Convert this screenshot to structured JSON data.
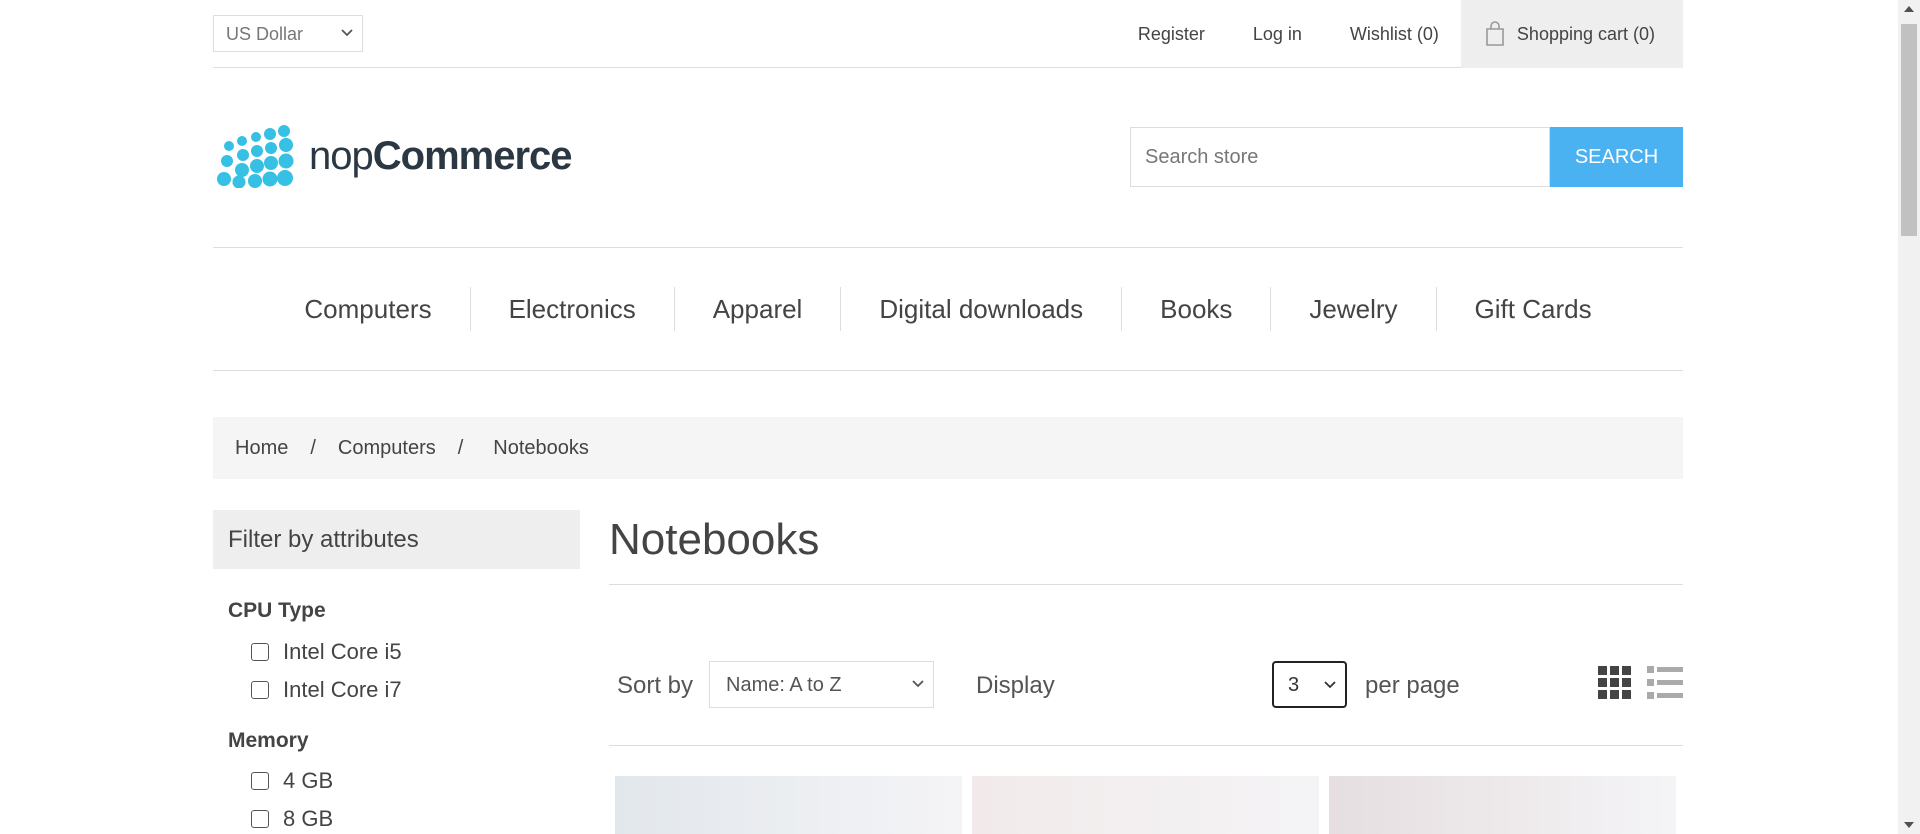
{
  "header": {
    "currency": "US Dollar",
    "links": [
      "Register",
      "Log in",
      "Wishlist (0)"
    ],
    "cart": "Shopping cart (0)"
  },
  "logo": {
    "prefix": "nop",
    "suffix": "Commerce"
  },
  "search": {
    "placeholder": "Search store",
    "button": "SEARCH"
  },
  "menu": [
    "Computers",
    "Electronics",
    "Apparel",
    "Digital downloads",
    "Books",
    "Jewelry",
    "Gift Cards"
  ],
  "breadcrumb": {
    "items": [
      "Home",
      "Computers"
    ],
    "separator": "/",
    "current": "Notebooks"
  },
  "sidebar": {
    "title": "Filter by attributes",
    "groups": [
      {
        "name": "CPU Type",
        "options": [
          "Intel Core i5",
          "Intel Core i7"
        ]
      },
      {
        "name": "Memory",
        "options": [
          "4 GB",
          "8 GB"
        ]
      }
    ]
  },
  "main": {
    "title": "Notebooks",
    "sort_label": "Sort by",
    "sort_value": "Name: A to Z",
    "display_label": "Display",
    "display_value": "3",
    "per_page_label": "per page"
  },
  "colors": {
    "accent": "#4ab2f1",
    "logo_dots": "#36c0e3",
    "product_tiles": [
      "#e2e7ec",
      "#f2eaea",
      "#e6dee0"
    ]
  }
}
